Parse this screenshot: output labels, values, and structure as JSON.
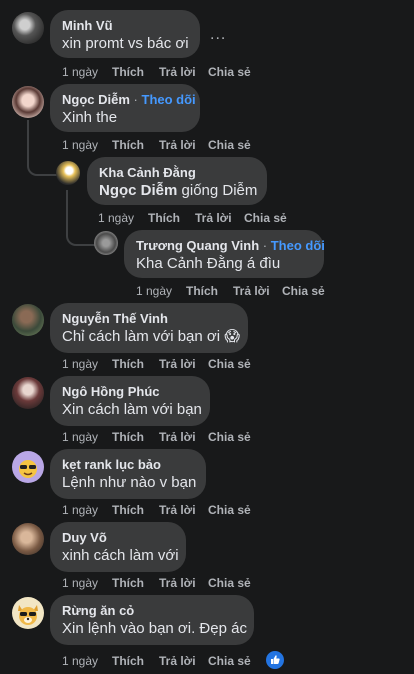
{
  "actions": {
    "like": "Thích",
    "reply": "Trả lời",
    "share": "Chia sẻ"
  },
  "follow_label": "Theo dõi",
  "more_label": "...",
  "comments": [
    {
      "name": "Minh Vũ",
      "text": "xin promt vs bác ơi",
      "time": "1 ngày"
    },
    {
      "name": "Ngọc Diễm",
      "text": "Xinh the",
      "time": "1 ngày",
      "follow": true
    },
    {
      "name": "Kha Cảnh Đằng",
      "mention": "Ngọc Diễm",
      "text": " giống Diễm",
      "time": "1 ngày"
    },
    {
      "name": "Trương Quang Vinh",
      "text": "Kha Cảnh Đằng á đìu",
      "time": "1 ngày",
      "follow": true
    },
    {
      "name": "Nguyễn Thế Vinh",
      "text": "Chỉ cách làm với bạn ơi 😱",
      "time": "1 ngày"
    },
    {
      "name": "Ngô Hồng Phúc",
      "text": "Xin cách làm với bạn",
      "time": "1 ngày"
    },
    {
      "name": "kẹt rank lục bảo",
      "text": "Lệnh như nào v bạn",
      "time": "1 ngày"
    },
    {
      "name": "Duy Võ",
      "text": "xinh cách làm với",
      "time": "1 ngày"
    },
    {
      "name": "Rừng ăn cỏ",
      "text": "Xin lệnh vào bạn ơi. Đẹp ác",
      "time": "1 ngày",
      "reaction": "like-reaction"
    }
  ],
  "colors": {
    "background": "#18191a",
    "bubble": "#3a3b3c",
    "follow": "#4599ff",
    "meta": "#b0b3b8"
  }
}
